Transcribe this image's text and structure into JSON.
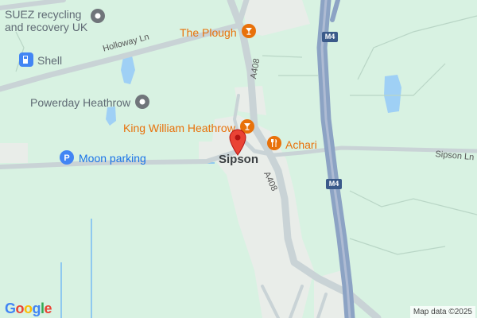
{
  "map": {
    "place_name": "Sipson",
    "pois": {
      "suez": "SUEZ recycling\nand recovery UK",
      "shell": "Shell",
      "powerday": "Powerday Heathrow",
      "plough": "The Plough",
      "king_william": "King William Heathrow",
      "achari": "Achari",
      "moon_parking": "Moon parking"
    },
    "roads": {
      "holloway_ln": "Holloway Ln",
      "a408_top": "A408",
      "a408_bottom": "A408",
      "sipson_ln": "Sipson Ln",
      "m4_top": "M4",
      "m4_bottom": "M4"
    },
    "attribution": "Map data ©2025",
    "logo": "Google",
    "colors": {
      "land": "#d8f2e2",
      "water": "#9fd0f5",
      "motorway": "#8ca3c4",
      "road": "#c9d3d6",
      "poi_orange": "#e8710a",
      "poi_gray": "#70757a",
      "poi_blue": "#4285f4",
      "pin": "#ea4335"
    }
  }
}
